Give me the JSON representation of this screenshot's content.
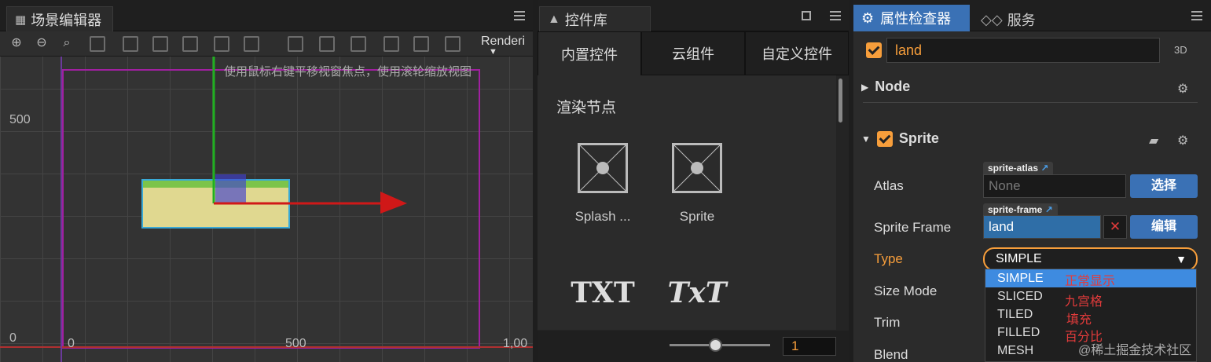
{
  "scene": {
    "tab_title": "场景编辑器",
    "render_label": "Renderi",
    "hint": "使用鼠标右键平移视窗焦点，使用滚轮缩放视图",
    "axis_labels": {
      "y500": "500",
      "y0": "0",
      "x0": "0",
      "x500": "500",
      "x1000": "1,00"
    },
    "colors": {
      "bounds": "#a020a0",
      "x_axis": "#d01818",
      "y_axis": "#20b020",
      "node_fill": "#e0d890",
      "node_border": "#39a9d6"
    },
    "toolbar_icons": [
      "zoom-in-icon",
      "zoom-out-icon",
      "zoom-reset-icon"
    ]
  },
  "library": {
    "tab_title": "控件库",
    "tabs": [
      "内置控件",
      "云组件",
      "自定义控件"
    ],
    "section_title": "渲染节点",
    "widgets": [
      {
        "label": "Splash ...",
        "icon": "image-placeholder-icon"
      },
      {
        "label": "Sprite",
        "icon": "image-placeholder-icon"
      },
      {
        "label": "",
        "icon": "label-icon",
        "glyph": "TXT"
      },
      {
        "label": "",
        "icon": "richtext-icon",
        "glyph": "TxT"
      }
    ],
    "zoom_value": "1"
  },
  "inspector": {
    "tab_title": "属性检查器",
    "tab_service": "服务",
    "node_name": "land",
    "mode_3d": "3D",
    "node_section": "Node",
    "sprite_section": "Sprite",
    "atlas": {
      "label": "Atlas",
      "tag": "sprite-atlas",
      "value": "None",
      "button": "选择"
    },
    "frame": {
      "label": "Sprite Frame",
      "tag": "sprite-frame",
      "value": "land",
      "button": "编辑"
    },
    "type": {
      "label": "Type",
      "value": "SIMPLE"
    },
    "size_mode_label": "Size Mode",
    "trim_label": "Trim",
    "blend_label": "Blend",
    "type_options": [
      {
        "label": "SIMPLE",
        "note": "正常显示"
      },
      {
        "label": "SLICED",
        "note": "九宫格"
      },
      {
        "label": "TILED",
        "note": "填充"
      },
      {
        "label": "FILLED",
        "note": "百分比"
      },
      {
        "label": "MESH",
        "note": ""
      }
    ],
    "watermark": "@稀土掘金技术社区",
    "accent": "#f79e3b",
    "selected_color": "#3e8be0"
  }
}
